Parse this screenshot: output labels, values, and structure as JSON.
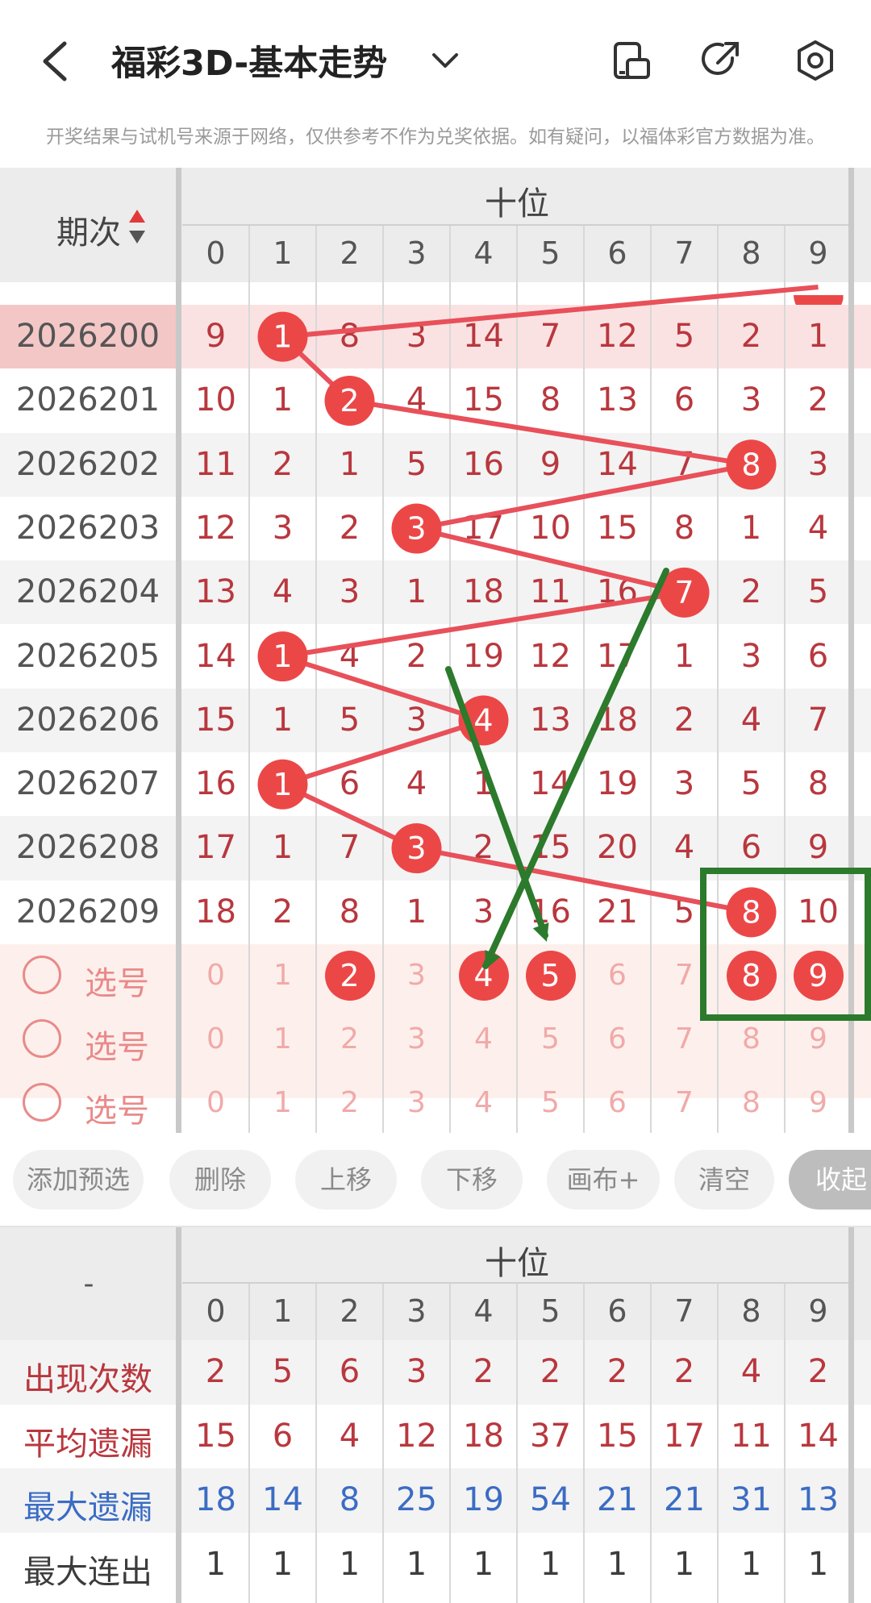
{
  "header": {
    "title": "福彩3D-基本走势",
    "disclaimer": "开奖结果与试机号来源于网络，仅供参考不作为兑奖依据。如有疑问，以福体彩官方数据为准。"
  },
  "grid": {
    "group_label": "十位",
    "issue_header": "期次",
    "digits": [
      "0",
      "1",
      "2",
      "3",
      "4",
      "5",
      "6",
      "7",
      "8",
      "9"
    ],
    "rows": [
      {
        "issue": "2026200",
        "values": [
          "9",
          "1",
          "8",
          "3",
          "14",
          "7",
          "12",
          "5",
          "2",
          "1"
        ],
        "hit": 1
      },
      {
        "issue": "2026201",
        "values": [
          "10",
          "1",
          "2",
          "4",
          "15",
          "8",
          "13",
          "6",
          "3",
          "2"
        ],
        "hit": 2
      },
      {
        "issue": "2026202",
        "values": [
          "11",
          "2",
          "1",
          "5",
          "16",
          "9",
          "14",
          "7",
          "8",
          "3"
        ],
        "hit": 8
      },
      {
        "issue": "2026203",
        "values": [
          "12",
          "3",
          "2",
          "3",
          "17",
          "10",
          "15",
          "8",
          "1",
          "4"
        ],
        "hit": 3
      },
      {
        "issue": "2026204",
        "values": [
          "13",
          "4",
          "3",
          "1",
          "18",
          "11",
          "16",
          "7",
          "2",
          "5"
        ],
        "hit": 7
      },
      {
        "issue": "2026205",
        "values": [
          "14",
          "1",
          "4",
          "2",
          "19",
          "12",
          "17",
          "1",
          "3",
          "6"
        ],
        "hit": 1
      },
      {
        "issue": "2026206",
        "values": [
          "15",
          "1",
          "5",
          "3",
          "4",
          "13",
          "18",
          "2",
          "4",
          "7"
        ],
        "hit": 4
      },
      {
        "issue": "2026207",
        "values": [
          "16",
          "1",
          "6",
          "4",
          "1",
          "14",
          "19",
          "3",
          "5",
          "8"
        ],
        "hit": 1
      },
      {
        "issue": "2026208",
        "values": [
          "17",
          "1",
          "7",
          "3",
          "2",
          "15",
          "20",
          "4",
          "6",
          "9"
        ],
        "hit": 3
      },
      {
        "issue": "2026209",
        "values": [
          "18",
          "2",
          "8",
          "1",
          "3",
          "16",
          "21",
          "5",
          "8",
          "10"
        ],
        "hit": 8
      }
    ],
    "pick_label": "选号",
    "pick_rows": [
      {
        "selected": [
          2,
          4,
          5,
          8,
          9
        ]
      },
      {
        "selected": []
      },
      {
        "selected": []
      }
    ]
  },
  "toolbar": {
    "buttons": [
      "添加预选",
      "删除",
      "上移",
      "下移",
      "画布+",
      "清空"
    ],
    "collapse": "收起"
  },
  "stats": {
    "group_label": "十位",
    "corner": "-",
    "digits": [
      "0",
      "1",
      "2",
      "3",
      "4",
      "5",
      "6",
      "7",
      "8",
      "9"
    ],
    "rows": [
      {
        "label": "出现次数",
        "values": [
          "2",
          "5",
          "6",
          "3",
          "2",
          "2",
          "2",
          "2",
          "4",
          "2"
        ],
        "color": "#b9373e"
      },
      {
        "label": "平均遗漏",
        "values": [
          "15",
          "6",
          "4",
          "12",
          "18",
          "37",
          "15",
          "17",
          "11",
          "14"
        ],
        "color": "#b9373e"
      },
      {
        "label": "最大遗漏",
        "values": [
          "18",
          "14",
          "8",
          "25",
          "19",
          "54",
          "21",
          "21",
          "31",
          "13"
        ],
        "color": "#3b6cc4"
      },
      {
        "label": "最大连出",
        "values": [
          "1",
          "1",
          "1",
          "1",
          "1",
          "1",
          "1",
          "1",
          "1",
          "1"
        ],
        "color": "#3c3c3c"
      }
    ]
  },
  "colors": {
    "ball": "#ec4747",
    "line": "#e8505a",
    "annotation": "#2c7a2c"
  }
}
